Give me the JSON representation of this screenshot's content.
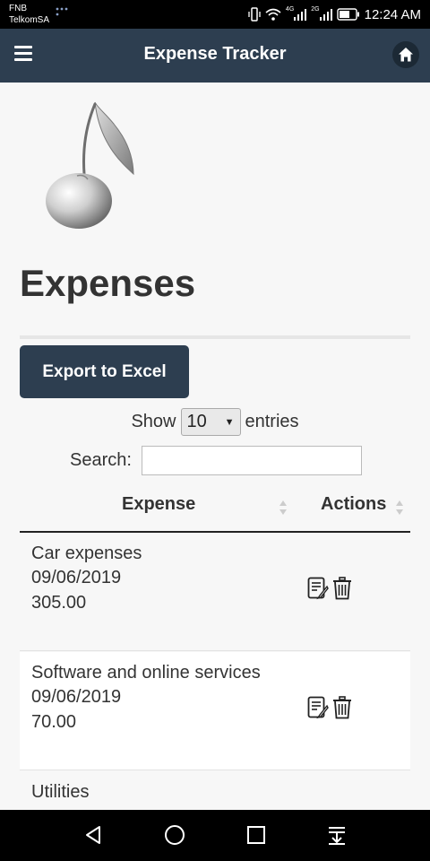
{
  "status_bar": {
    "carrier_1": "FNB",
    "carrier_2": "TelkomSA",
    "network_1": "4G",
    "network_2": "2G",
    "time": "12:24 AM"
  },
  "app_bar": {
    "menu_icon": "hamburger-icon",
    "title": "Expense Tracker",
    "home_icon": "home-icon"
  },
  "page": {
    "title": "Expenses",
    "export_button": "Export to Excel"
  },
  "table_controls": {
    "show_label": "Show",
    "page_length": "10",
    "entries_label": "entries",
    "search_label": "Search:",
    "search_value": ""
  },
  "table": {
    "columns": [
      "Expense",
      "Actions"
    ],
    "rows": [
      {
        "name": "Car expenses",
        "date": "09/06/2019",
        "amount": "305.00"
      },
      {
        "name": "Software and online services",
        "date": "09/06/2019",
        "amount": "70.00"
      },
      {
        "name": "Utilities",
        "date": "",
        "amount": ""
      }
    ],
    "action_icons": [
      "edit-icon",
      "delete-icon"
    ]
  },
  "nav_bar": {
    "icons": [
      "back-icon",
      "home-circle-icon",
      "recents-icon",
      "notifications-pull-icon"
    ]
  },
  "colors": {
    "primary": "#2d3e50",
    "background": "#f7f7f7",
    "text": "#333333"
  }
}
